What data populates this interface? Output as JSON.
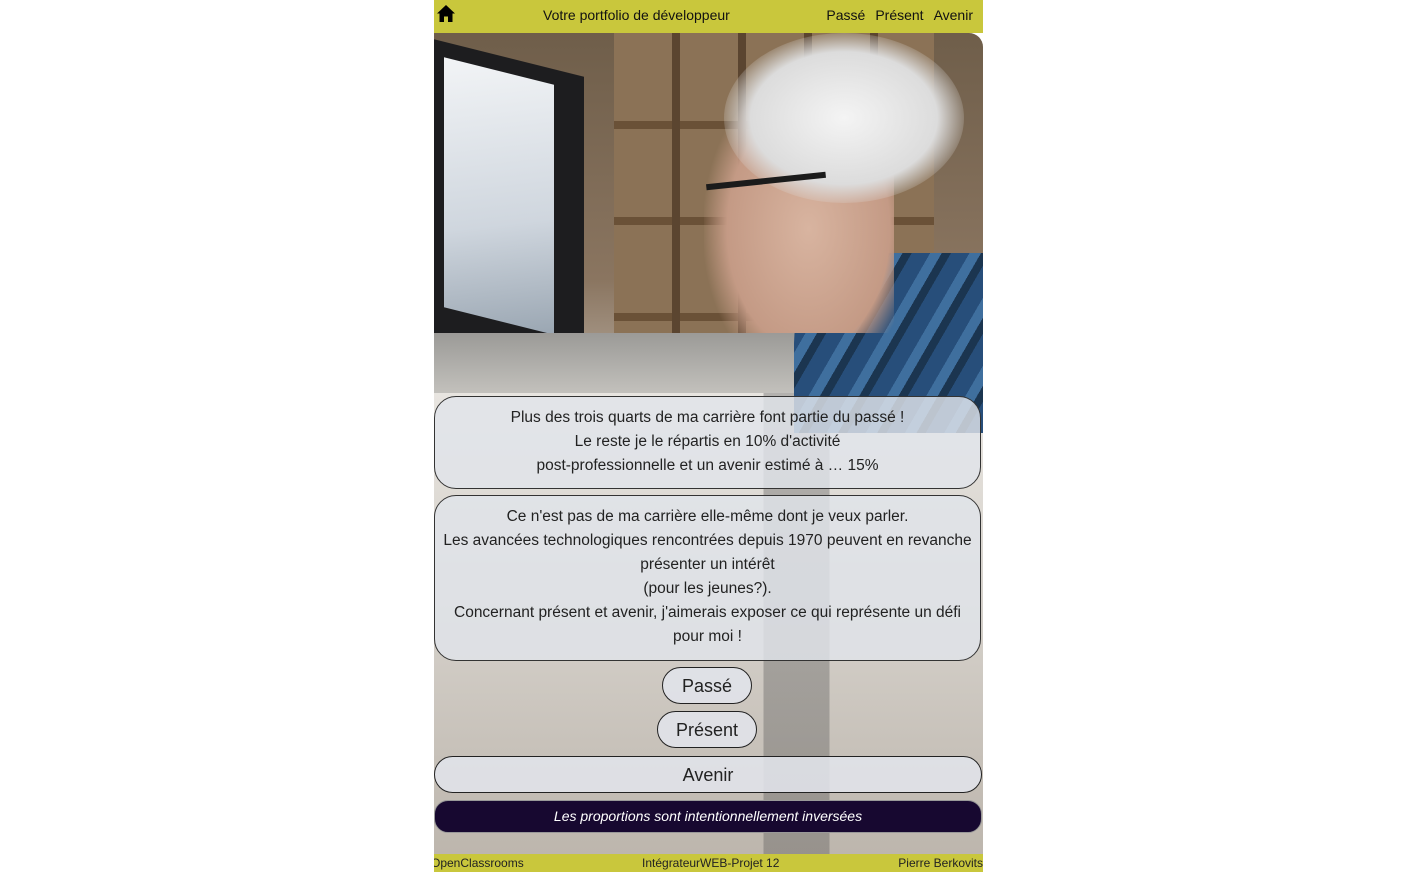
{
  "header": {
    "home_icon": "home-icon",
    "title": "Votre portfolio de développeur",
    "nav": [
      "Passé",
      "Présent",
      "Avenir"
    ]
  },
  "hero_image": "photo of developer at computer",
  "cards": [
    {
      "lines": [
        "Plus des trois quarts de ma carrière font partie du passé !",
        "Le reste je le répartis en 10% d'activité",
        "post-professionnelle et un avenir estimé à … 15%"
      ]
    },
    {
      "lines": [
        "Ce n'est pas de ma carrière elle-même dont je veux parler.",
        "Les avancées technologiques rencontrées depuis 1970 peuvent en revanche présenter un intérêt",
        "(pour les jeunes?).",
        "Concernant présent et avenir, j'aimerais exposer ce qui représente un défi pour moi !"
      ]
    }
  ],
  "buttons": {
    "passe": "Passé",
    "present": "Présent",
    "avenir": "Avenir"
  },
  "note": "Les proportions sont intentionnellement inversées",
  "footer": {
    "left": "OpenClassrooms",
    "middle": "IntégrateurWEB-Projet 12",
    "right": "Pierre Berkovits"
  },
  "colors": {
    "header_bg": "#c9c73c",
    "note_bg": "#170830",
    "card_bg": "#e1e4ea"
  }
}
